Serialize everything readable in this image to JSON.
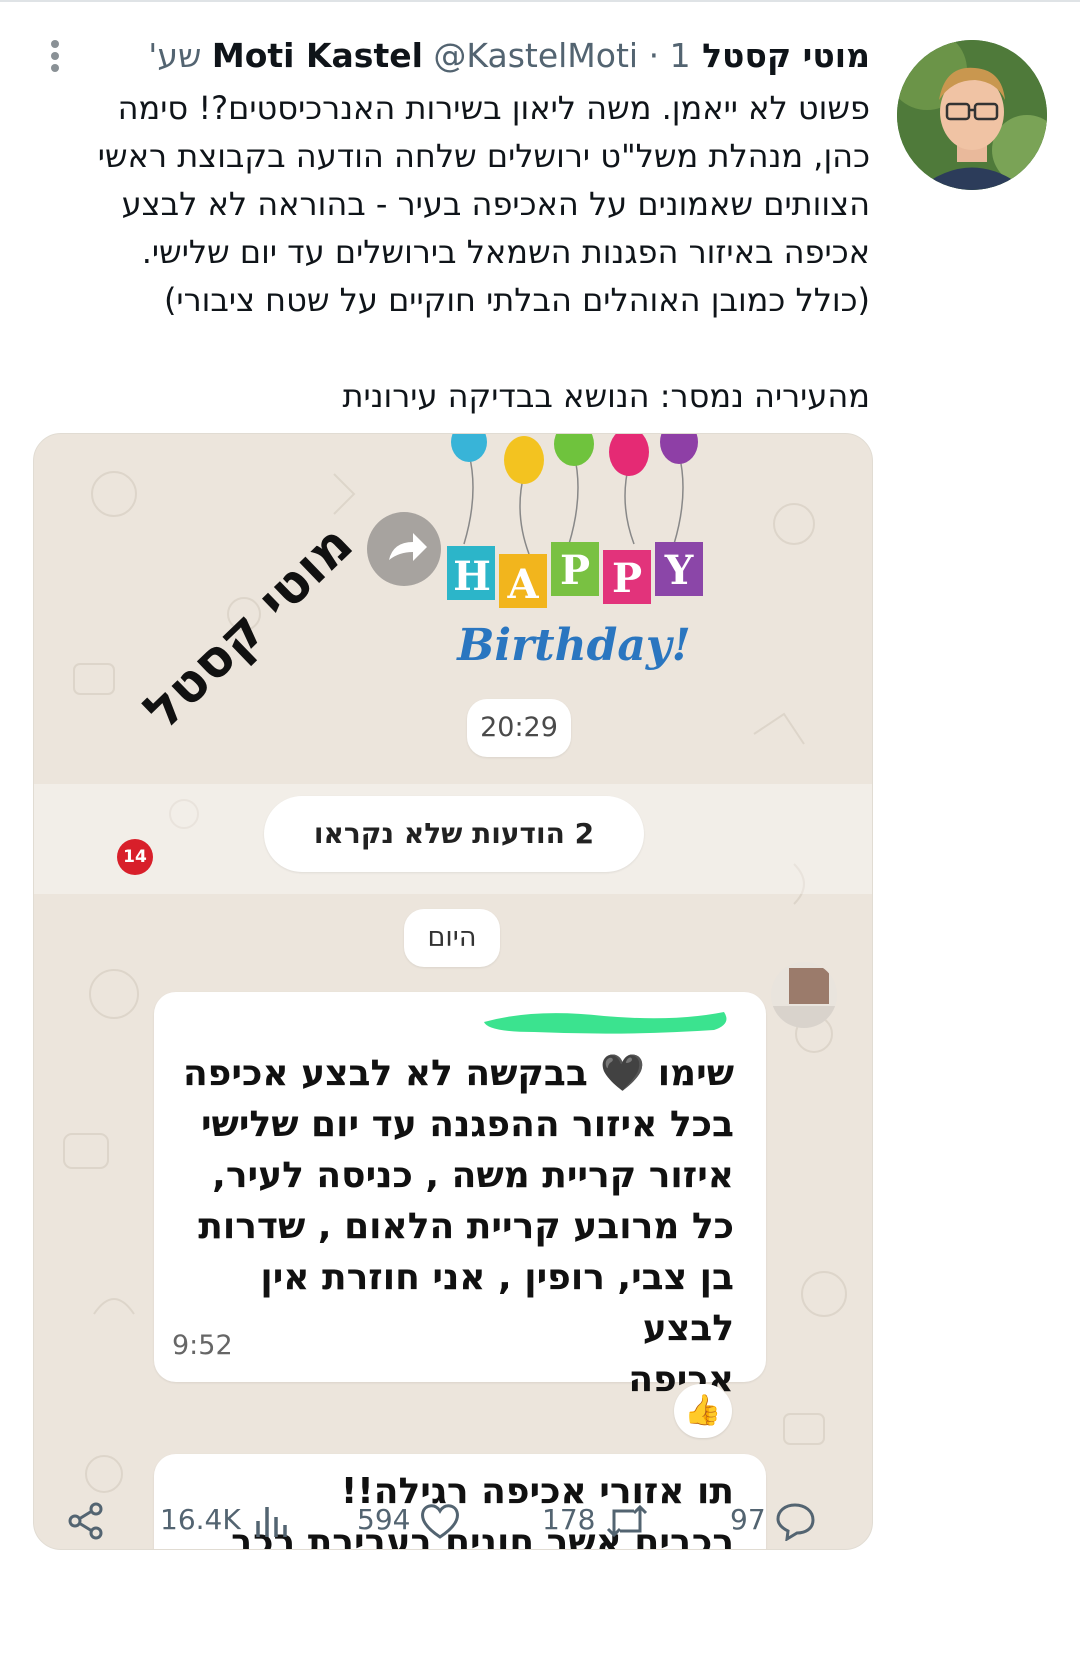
{
  "tweet": {
    "author_name": "מוטי קסטל Moti Kastel",
    "handle": "@KastelMoti",
    "separator": "·",
    "time": "1 שע'",
    "text_lines": [
      "פשוט לא ייאמן. משה ליאון בשירות האנרכיסטים?! סימה",
      "כהן, מנהלת משל\"ט ירושלים שלחה הודעה בקבוצת ראשי",
      "הצוותים שאמונים על האכיפה בעיר - בהוראה לא לבצע",
      "אכיפה באיזור הפגנות השמאל בירושלים עד יום שלישי.",
      "(כולל כמובן האוהלים הבלתי חוקיים על שטח ציבורי)"
    ],
    "municipality_line": "מהעיריה נמסר: הנושא בבדיקה עירונית"
  },
  "media": {
    "birthday_sticker": {
      "happy": "HAPPY",
      "birthday": "Birthday!"
    },
    "time_pill": "20:29",
    "unread_pill": "2 הודעות שלא נקראו",
    "today_pill": "היום",
    "message1": {
      "lines": [
        "שימו 🖤 בבקשה לא לבצע אכיפה",
        "בכל איזור ההפגנה עד יום שלישי",
        "איזור קריית משה , כניסה לעיר,",
        "כל מרובע קריית הלאום , שדרות",
        "בן צבי, רופין , אני חוזרת אין לבצע",
        "אכיפה"
      ],
      "time": "9:52",
      "reaction": "👍"
    },
    "message2": {
      "lines": [
        "תו אזורי אכיפה רגילה!!",
        "רכבים אשר חונים בעבירת רכב"
      ]
    },
    "watermark": {
      "text": "מוטי קסטל",
      "badge": "14"
    }
  },
  "stats": {
    "views": "16.4K",
    "likes": "594",
    "retweets": "178",
    "replies": "97"
  },
  "colors": {
    "text": "#0f1419",
    "muted": "#536471",
    "chat_bg": "#ece5dc",
    "redaction": "#3be38f"
  }
}
